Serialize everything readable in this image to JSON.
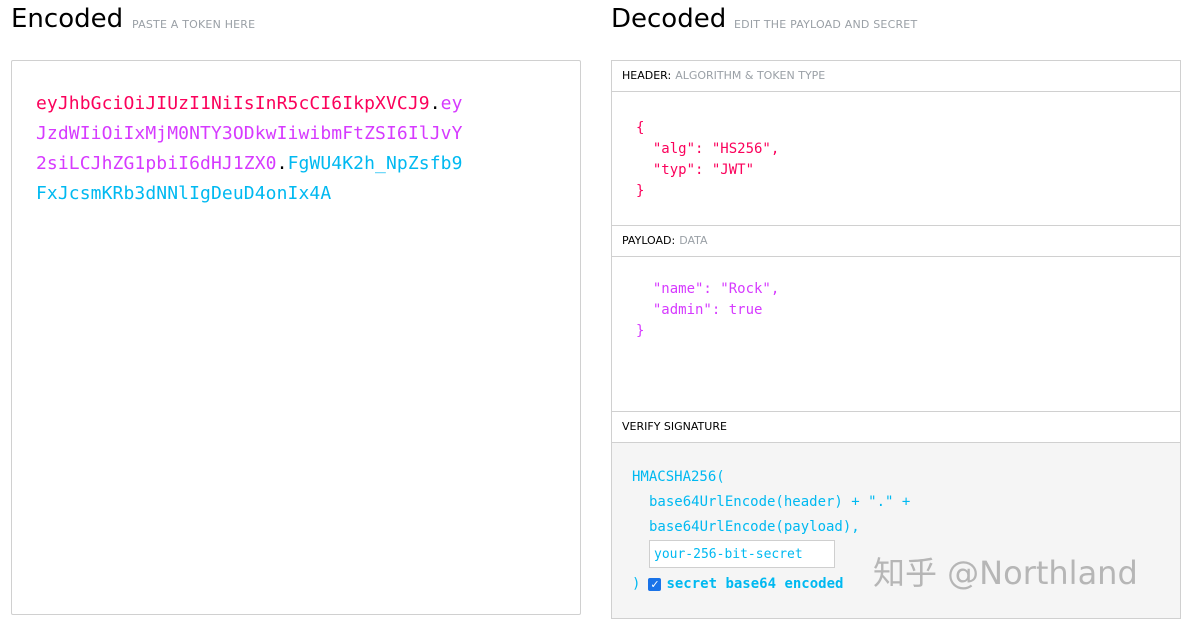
{
  "encoded": {
    "title": "Encoded",
    "subtitle": "PASTE A TOKEN HERE",
    "token_lines": [
      [
        {
          "text": "eyJhbGciOiJIUzI1NiIsInR5cCI6IkpXVCJ9",
          "part": "header"
        },
        {
          "text": ".",
          "part": "dot"
        },
        {
          "text": "ey",
          "part": "payload"
        }
      ],
      [
        {
          "text": "JzdWIiOiIxMjM0NTY3ODkwIiwibmFtZSI6IlJvY",
          "part": "payload"
        }
      ],
      [
        {
          "text": "2siLCJhZG1pbiI6dHJ1ZX0",
          "part": "payload"
        },
        {
          "text": ".",
          "part": "dot"
        },
        {
          "text": "FgWU4K2h_NpZsfb9",
          "part": "sig"
        }
      ],
      [
        {
          "text": "FxJcsmKRb3dNNlIgDeuD4onIx4A",
          "part": "sig"
        }
      ]
    ]
  },
  "decoded": {
    "title": "Decoded",
    "subtitle": "EDIT THE PAYLOAD AND SECRET",
    "header_section": {
      "label": "HEADER:",
      "sublabel": "ALGORITHM & TOKEN TYPE",
      "lines": [
        "{",
        "  \"alg\": \"HS256\",",
        "  \"typ\": \"JWT\"",
        "}"
      ]
    },
    "payload_section": {
      "label": "PAYLOAD:",
      "sublabel": "DATA",
      "lines": [
        "  \"name\": \"Rock\",",
        "  \"admin\": true",
        "}"
      ]
    },
    "signature_section": {
      "label": "VERIFY SIGNATURE",
      "line1": "HMACSHA256(",
      "line2": "base64UrlEncode(header) + \".\" +",
      "line3": "base64UrlEncode(payload),",
      "secret_placeholder": "your-256-bit-secret",
      "closing": ")",
      "checkbox_label": "secret base64 encoded",
      "checkbox_checked": true
    }
  },
  "watermark": "知乎 @Northland",
  "colors": {
    "header": "#fb015b",
    "payload": "#d63aff",
    "signature": "#00b9f1"
  }
}
